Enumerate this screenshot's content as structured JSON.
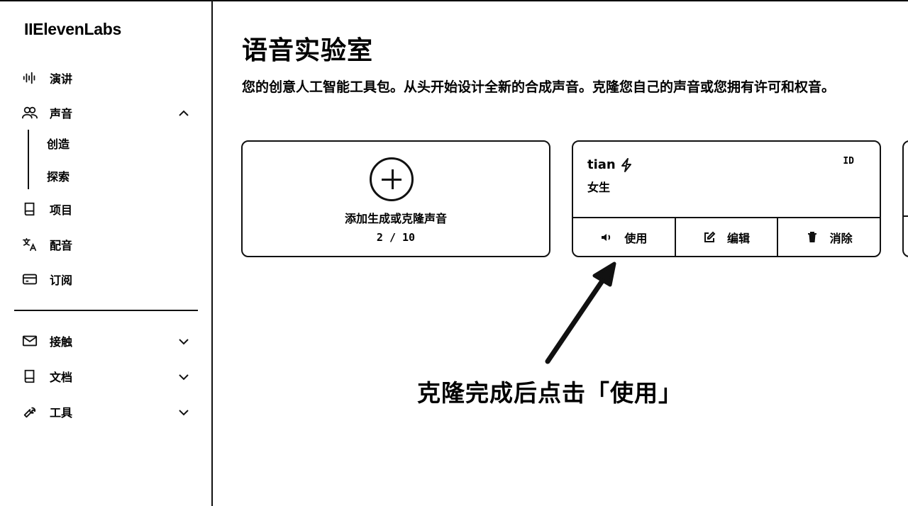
{
  "brand": {
    "logo_text": "IIElevenLabs"
  },
  "sidebar": {
    "items": [
      {
        "label": "演讲",
        "icon": "waveform-icon"
      },
      {
        "label": "声音",
        "icon": "users-icon",
        "expanded": true
      },
      {
        "label": "项目",
        "icon": "book-icon"
      },
      {
        "label": "配音",
        "icon": "translate-icon"
      },
      {
        "label": "订阅",
        "icon": "card-icon"
      }
    ],
    "voice_sub": [
      "创造",
      "探索"
    ],
    "bottom_items": [
      {
        "label": "接触",
        "icon": "mail-icon"
      },
      {
        "label": "文档",
        "icon": "book-icon"
      },
      {
        "label": "工具",
        "icon": "wrench-icon"
      }
    ]
  },
  "main": {
    "title": "语音实验室",
    "description": "您的创意人工智能工具包。从头开始设计全新的合成声音。克隆您自己的声音或您拥有许可和权音。",
    "add_card": {
      "label": "添加生成或克隆声音",
      "count": "2 / 10"
    },
    "voice_card": {
      "name": "tian",
      "tag": "女生",
      "id_label": "ID",
      "actions": {
        "use": "使用",
        "edit": "编辑",
        "delete": "消除"
      }
    }
  },
  "annotation": {
    "text": "克隆完成后点击「使用」"
  }
}
